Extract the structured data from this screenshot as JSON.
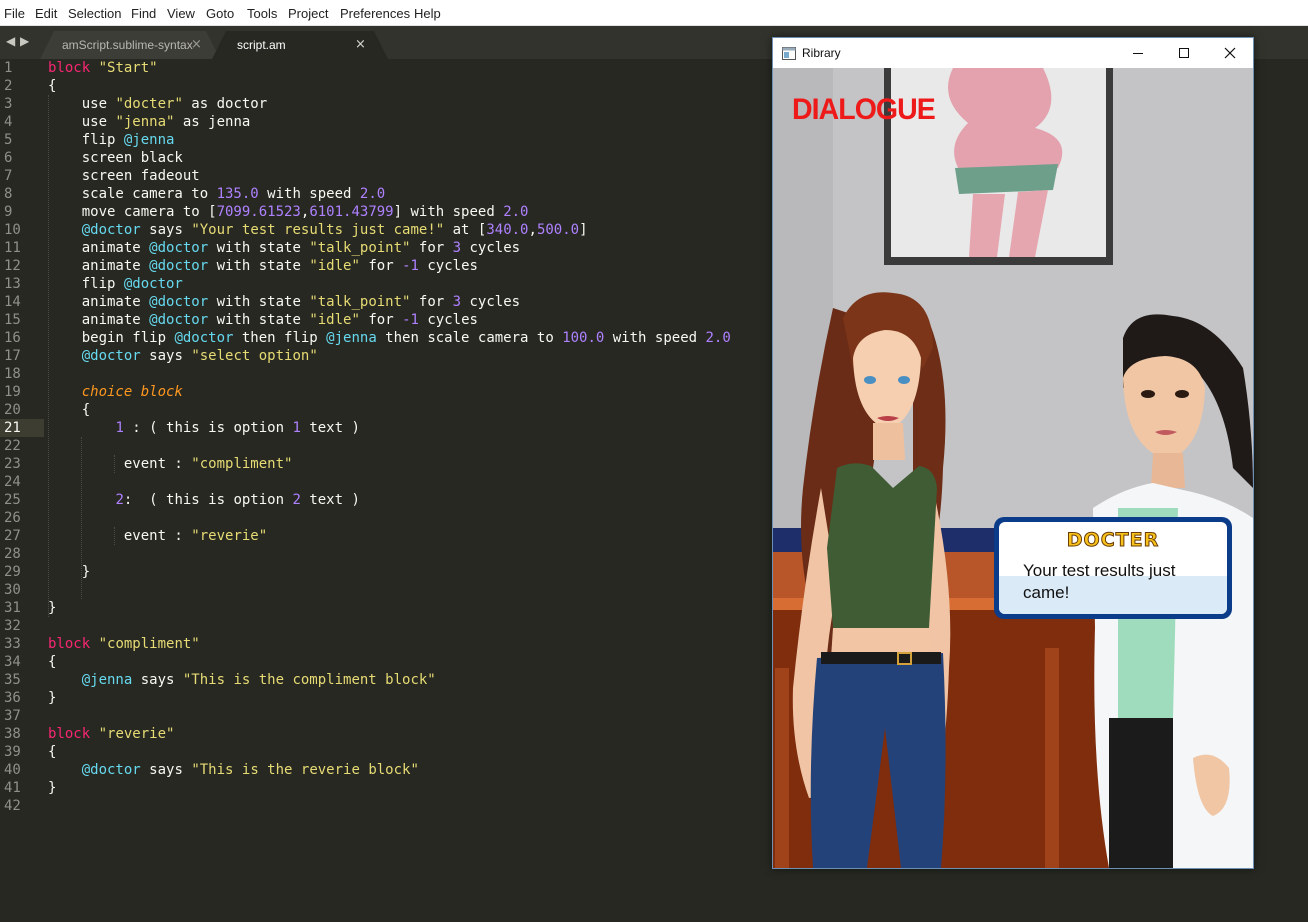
{
  "menu": [
    "File",
    "Edit",
    "Selection",
    "Find",
    "View",
    "Goto",
    "Tools",
    "Project",
    "Preferences",
    "Help"
  ],
  "tabs": [
    {
      "label": "amScript.sublime-syntax",
      "active": false
    },
    {
      "label": "script.am",
      "active": true
    }
  ],
  "editor": {
    "active_line": 21,
    "line_count": 42,
    "theme_colors": {
      "keyword": "#f92672",
      "string": "#e6db74",
      "number": "#ae81ff",
      "variable": "#66d9ef",
      "italic_keyword": "#fd971f",
      "text": "#f8f8f2",
      "background": "#272822"
    }
  },
  "window": {
    "title": "Ribrary",
    "controls": [
      "minimize-icon",
      "maximize-icon",
      "close-icon"
    ]
  },
  "game": {
    "overlay_label": "DIALOGUE",
    "speaker": "DOCTER",
    "speech": "Your test results just came!"
  }
}
